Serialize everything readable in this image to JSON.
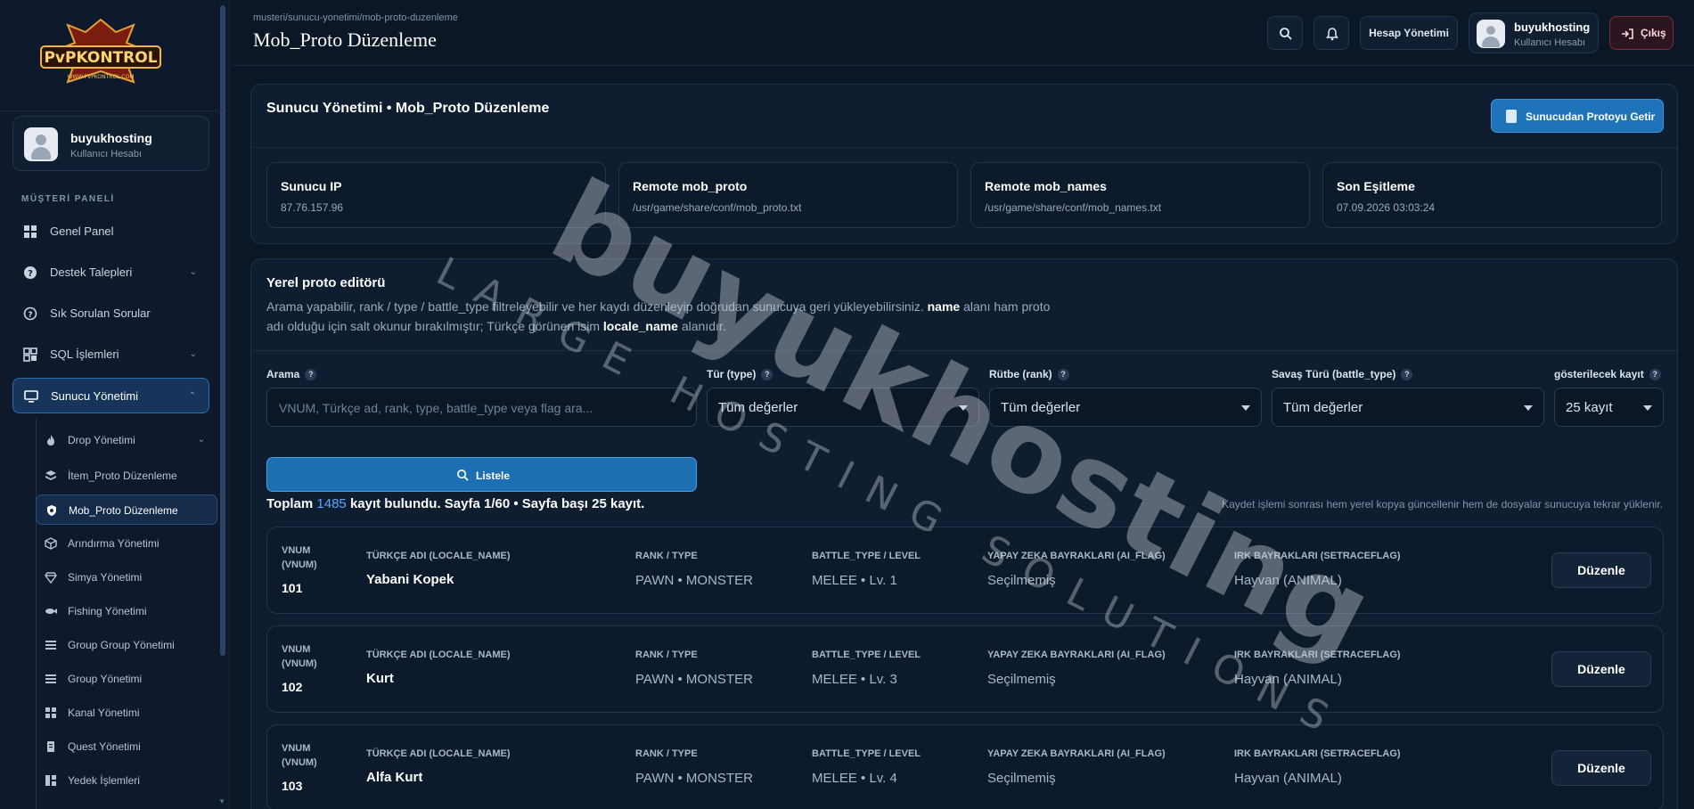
{
  "brand": {
    "logo_text": "PvPKONTROL",
    "logo_sub": "WWW.PVPKONTROL.COM"
  },
  "sidebar": {
    "user": {
      "name": "buyukhosting",
      "subtitle": "Kullanıcı Hesabı"
    },
    "section_label": "MÜŞTERİ PANELİ",
    "items": [
      {
        "label": "Genel Panel",
        "icon": "dashboard-icon"
      },
      {
        "label": "Destek Talepleri",
        "icon": "support-icon"
      },
      {
        "label": "Sık Sorulan Sorular",
        "icon": "help-icon"
      },
      {
        "label": "SQL İşlemleri",
        "icon": "grid-icon"
      },
      {
        "label": "Sunucu Yönetimi",
        "icon": "monitor-icon"
      }
    ],
    "subitems": [
      {
        "label": "Drop Yönetimi"
      },
      {
        "label": "İtem_Proto Düzenleme"
      },
      {
        "label": "Mob_Proto Düzenleme"
      },
      {
        "label": "Arındırma Yönetimi"
      },
      {
        "label": "Simya Yönetimi"
      },
      {
        "label": "Fishing Yönetimi"
      },
      {
        "label": "Group Group Yönetimi"
      },
      {
        "label": "Group Yönetimi"
      },
      {
        "label": "Kanal Yönetimi"
      },
      {
        "label": "Quest Yönetimi"
      },
      {
        "label": "Yedek İşlemleri"
      }
    ]
  },
  "header": {
    "breadcrumb": "musteri/sunucu-yonetimi/mob-proto-duzenleme",
    "title": "Mob_Proto Düzenleme",
    "account_label": "Hesap Yönetimi",
    "user_name": "buyukhosting",
    "user_sub": "Kullanıcı Hesabı",
    "logout_label": "Çıkış"
  },
  "server_panel": {
    "title": "Sunucu Yönetimi • Mob_Proto Düzenleme",
    "fetch_button": "Sunucudan Protoyu Getir",
    "cards": [
      {
        "title": "Sunucu IP",
        "value": "87.76.157.96"
      },
      {
        "title": "Remote mob_proto",
        "value": "/usr/game/share/conf/mob_proto.txt"
      },
      {
        "title": "Remote mob_names",
        "value": "/usr/game/share/conf/mob_names.txt"
      },
      {
        "title": "Son Eşitleme",
        "value": "07.09.2026 03:03:24"
      }
    ]
  },
  "editor": {
    "title": "Yerel proto editörü",
    "desc_1": "Arama yapabilir, rank / type / battle_type filtreleyebilir ve her kaydı düzenleyip doğrudan sunucuya geri yükleyebilirsiniz.",
    "desc_name": "name",
    "desc_2": "alanı ham proto adı olduğu için salt okunur bırakılmıştır; Türkçe görünen isim",
    "desc_locale": "locale_name",
    "desc_3": "alanıdır.",
    "filters": {
      "search_label": "Arama",
      "search_placeholder": "VNUM, Türkçe ad, rank, type, battle_type veya flag ara...",
      "type_label": "Tür (type)",
      "type_value": "Tüm değerler",
      "rank_label": "Rütbe (rank)",
      "rank_value": "Tüm değerler",
      "battle_label": "Savaş Türü (battle_type)",
      "battle_value": "Tüm değerler",
      "show_label": "gösterilecek kayıt",
      "show_value": "25 kayıt"
    },
    "list_button": "Listele",
    "total_prefix": "Toplam",
    "total_count": "1485",
    "total_suffix": "kayıt bulundu. Sayfa 1/60 • Sayfa başı 25 kayıt.",
    "note": "Kaydet işlemi sonrası hem yerel kopya güncellenir hem de dosyalar sunucuya tekrar yüklenir.",
    "columns": {
      "vnum": "VNUM (VNUM)",
      "name": "TÜRKÇE ADI (LOCALE_NAME)",
      "rank": "RANK / TYPE",
      "battle": "BATTLE_TYPE / LEVEL",
      "ai": "YAPAY ZEKA BAYRAKLARI (AI_FLAG)",
      "race": "IRK BAYRAKLARI (SETRACEFLAG)"
    },
    "edit_label": "Düzenle",
    "rows": [
      {
        "vnum": "101",
        "name": "Yabani Kopek",
        "rank": "PAWN • MONSTER",
        "battle": "MELEE • Lv. 1",
        "ai": "Seçilmemiş",
        "race": "Hayvan (ANIMAL)"
      },
      {
        "vnum": "102",
        "name": "Kurt",
        "rank": "PAWN • MONSTER",
        "battle": "MELEE • Lv. 3",
        "ai": "Seçilmemiş",
        "race": "Hayvan (ANIMAL)"
      },
      {
        "vnum": "103",
        "name": "Alfa Kurt",
        "rank": "PAWN • MONSTER",
        "battle": "MELEE • Lv. 4",
        "ai": "Seçilmemiş",
        "race": "Hayvan (ANIMAL)"
      }
    ]
  },
  "watermark": {
    "main": "buyukhosting",
    "sub": "LARGE HOSTING SOLUTIONS"
  },
  "colors": {
    "background": "#0b1626",
    "panel": "#0f1d30",
    "accent": "#1f73b8",
    "logout": "#7a2b3b"
  }
}
